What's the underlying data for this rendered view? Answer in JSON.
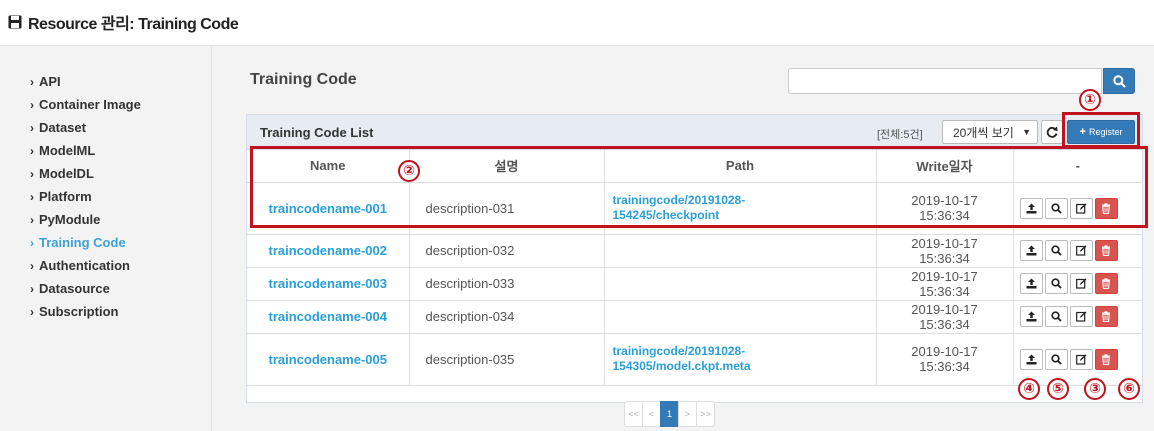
{
  "page_title": "Resource 관리: Training Code",
  "sidebar": {
    "items": [
      {
        "label": "API",
        "active": false
      },
      {
        "label": "Container Image",
        "active": false
      },
      {
        "label": "Dataset",
        "active": false
      },
      {
        "label": "ModelML",
        "active": false
      },
      {
        "label": "ModelDL",
        "active": false
      },
      {
        "label": "Platform",
        "active": false
      },
      {
        "label": "PyModule",
        "active": false
      },
      {
        "label": "Training Code",
        "active": true
      },
      {
        "label": "Authentication",
        "active": false
      },
      {
        "label": "Datasource",
        "active": false
      },
      {
        "label": "Subscription",
        "active": false
      }
    ]
  },
  "main": {
    "title": "Training Code",
    "search": {
      "value": "",
      "placeholder": ""
    },
    "panel": {
      "title": "Training Code List",
      "total": "[전체:5건]",
      "page_size": "20개씩 보기",
      "register_label": "Register"
    },
    "table": {
      "headers": [
        "Name",
        "설명",
        "Path",
        "Write일자",
        "-"
      ],
      "rows": [
        {
          "name": "traincodename-001",
          "description": "description-031",
          "path_line1": "trainingcode/20191028-",
          "path_line2": "154245/checkpoint",
          "date": "2019-10-17 15:36:34"
        },
        {
          "name": "traincodename-002",
          "description": "description-032",
          "path_line1": "",
          "path_line2": "",
          "date": "2019-10-17 15:36:34"
        },
        {
          "name": "traincodename-003",
          "description": "description-033",
          "path_line1": "",
          "path_line2": "",
          "date": "2019-10-17 15:36:34"
        },
        {
          "name": "traincodename-004",
          "description": "description-034",
          "path_line1": "",
          "path_line2": "",
          "date": "2019-10-17 15:36:34"
        },
        {
          "name": "traincodename-005",
          "description": "description-035",
          "path_line1": "trainingcode/20191028-",
          "path_line2": "154305/model.ckpt.meta",
          "date": "2019-10-17 15:36:34"
        }
      ]
    },
    "pagination": {
      "first": "<<",
      "prev": "<",
      "current": "1",
      "next": ">",
      "last": ">>"
    }
  },
  "annotations": [
    "①",
    "②",
    "③",
    "④",
    "⑤",
    "⑥"
  ],
  "colors": {
    "accent": "#337ab7",
    "link": "#2a9fd8",
    "highlight": "#c1121f",
    "danger": "#d9534f"
  }
}
